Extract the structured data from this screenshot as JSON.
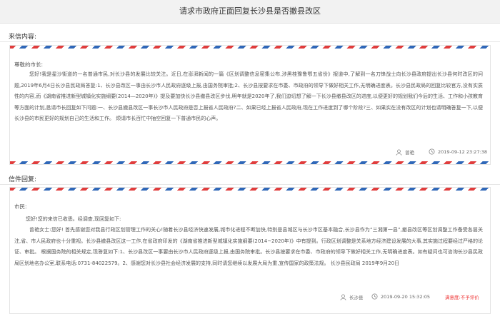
{
  "header": {
    "title": "请求市政府正面回复长沙县是否撤县改区"
  },
  "letter": {
    "section_label": "来信内容:",
    "salutation": "尊敬的市长:",
    "body": "您好!我是星沙街道的一名普通市民,对长沙县的发展比较关注。近日,在澎湃新闻的一篇《区划调整信息密集公布,涉黑桂豫鲁鄂五省份》报道中,了解到一名刀锋战士向长沙县政府提出长沙县何时改区的问题,2019年6月4日长沙县民政局答复:1、长沙县改区一事由长沙市人民政府逐级上报,由国务院审批;2、长沙县按要求在市委、市政府的领导下做好相关工作,无明确进度表。长沙县民政局的回复比较官方,没有实质性的内容,而《湖南省推进新型城镇化实施纲要(2014—2020年)》提及要加快长沙县撤县改区步伐,明年就是2020年了,我们迫切想了解一下长沙县撤县改区的进度,以便更好的规划我们今后的生活、工作和小孩教育等方面的计划,恳请市长回复如下问题:一、长沙县撤县改区一事长沙市人民政府是否上报省人民政府?二、如果已经上报省人民政府,现在工作进度到了哪个阶段?三、如果实在没有改区的计划也请明确答复一下,以便长沙县的市民更好的规划自己的生活和工作。 烦请市长百忙中抽空回复一下普通市民的心声。",
    "author": "曾艳",
    "time": "2019-09-12 23:27:38"
  },
  "reply": {
    "section_label": "信件回复:",
    "salutation": "市民:",
    "intro": "您好!您的来信已收悉。经调查,现回复如下:",
    "body": "曾艳女士:您好! 首先感谢您对我县行政区划管理工作的关心!随着长沙县经济快速发展,城市化进程不断加快,特别是县城区与长沙市区基本融合,长沙县作为“三湘第一县”,撤县改区等区划调整工作备受各层关注,省、市人民政府也十分重视。长沙县撤县改区这一工作,在省政府印发的《湖南省推进新型城镇化实施纲要(2014~2020年)》中有提到。行政区划调整是关系地方经济建设发展的大事,其实施过程要经过严格的论证、审批。 根据国务院的相关规定,现答复如下:1、长沙县改区一事要由长沙市人民政府逐级上报,由国务院审批。长沙县按要求在市委、市政府的领导下做好相关工作,无明确进度表。如有疑问也可咨询长沙县民政局区划地名办公室,联系电话:0731-84022579。2、感谢您对长沙县社会经济发展的支持,同时请您继续以发展大局为重,宣传国家的政策法规。 长沙县民政局 2019年9月20日",
    "author": "长沙县",
    "time": "2019-09-20 15:32:05",
    "satisfaction_label": "满意度:",
    "satisfaction_value": "不予评价"
  },
  "colors": {
    "airmail_red": "#e03c3c",
    "airmail_blue": "#2f67b8",
    "satisfaction": "#e33333"
  }
}
